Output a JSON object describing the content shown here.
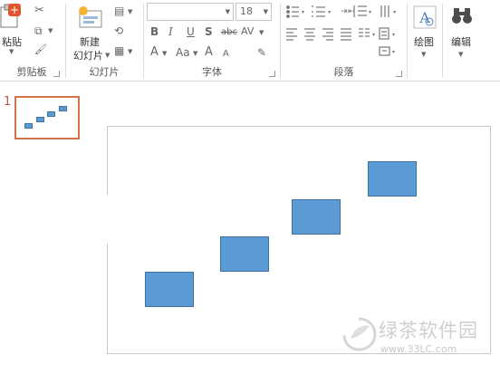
{
  "clipboard": {
    "paste_label": "粘贴",
    "group_label": "剪贴板"
  },
  "slides": {
    "new_slide_line1": "新建",
    "new_slide_line2": "幻灯片",
    "group_label": "幻灯片"
  },
  "font": {
    "size_value": "18",
    "group_label": "字体"
  },
  "paragraph": {
    "group_label": "段落"
  },
  "drawing": {
    "label": "绘图"
  },
  "editing": {
    "label": "编辑"
  },
  "thumbnail": {
    "number": "1"
  },
  "watermark": {
    "name": "绿茶软件园",
    "url": "www.33LC.com"
  },
  "colors": {
    "shape_fill": "#5b9bd5",
    "shape_border": "#41719c",
    "selected_thumb_border": "#d2734a"
  },
  "icons": {
    "bold": "B",
    "italic": "I",
    "underline": "U",
    "shadow": "S",
    "strike": "abc",
    "spacing": "AV",
    "font_color": "A",
    "change_case": "Aa",
    "grow": "A",
    "shrink": "A",
    "clear": "✎",
    "cut": "✂",
    "copy": "⧉",
    "format_painter": "🖌",
    "layout": "▤",
    "reset": "⟲",
    "section": "▦"
  }
}
